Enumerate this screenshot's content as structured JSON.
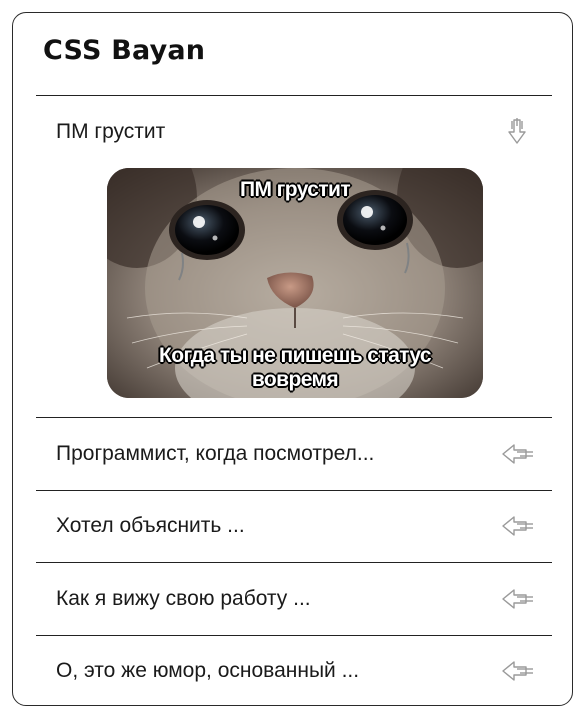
{
  "card": {
    "title": "CSS Bayan"
  },
  "accordion": {
    "expanded": {
      "label": "ПМ грустит",
      "icon": "arrow-down-icon",
      "meme": {
        "top_text": "ПМ грустит",
        "bottom_text_line1": "Когда ты не пишешь статус",
        "bottom_text_line2": "вовремя"
      }
    },
    "collapsed": [
      {
        "label": "Программист, когда посмотрел...",
        "icon": "arrow-left-icon"
      },
      {
        "label": "Хотел объяснить ...",
        "icon": "arrow-left-icon"
      },
      {
        "label": "Как я вижу свою работу ...",
        "icon": "arrow-left-icon"
      },
      {
        "label": "О, это же юмор, основанный ...",
        "icon": "arrow-left-icon"
      }
    ]
  },
  "colors": {
    "border": "#222222",
    "icon": "#9a9a9a",
    "text": "#1a1a1a"
  }
}
